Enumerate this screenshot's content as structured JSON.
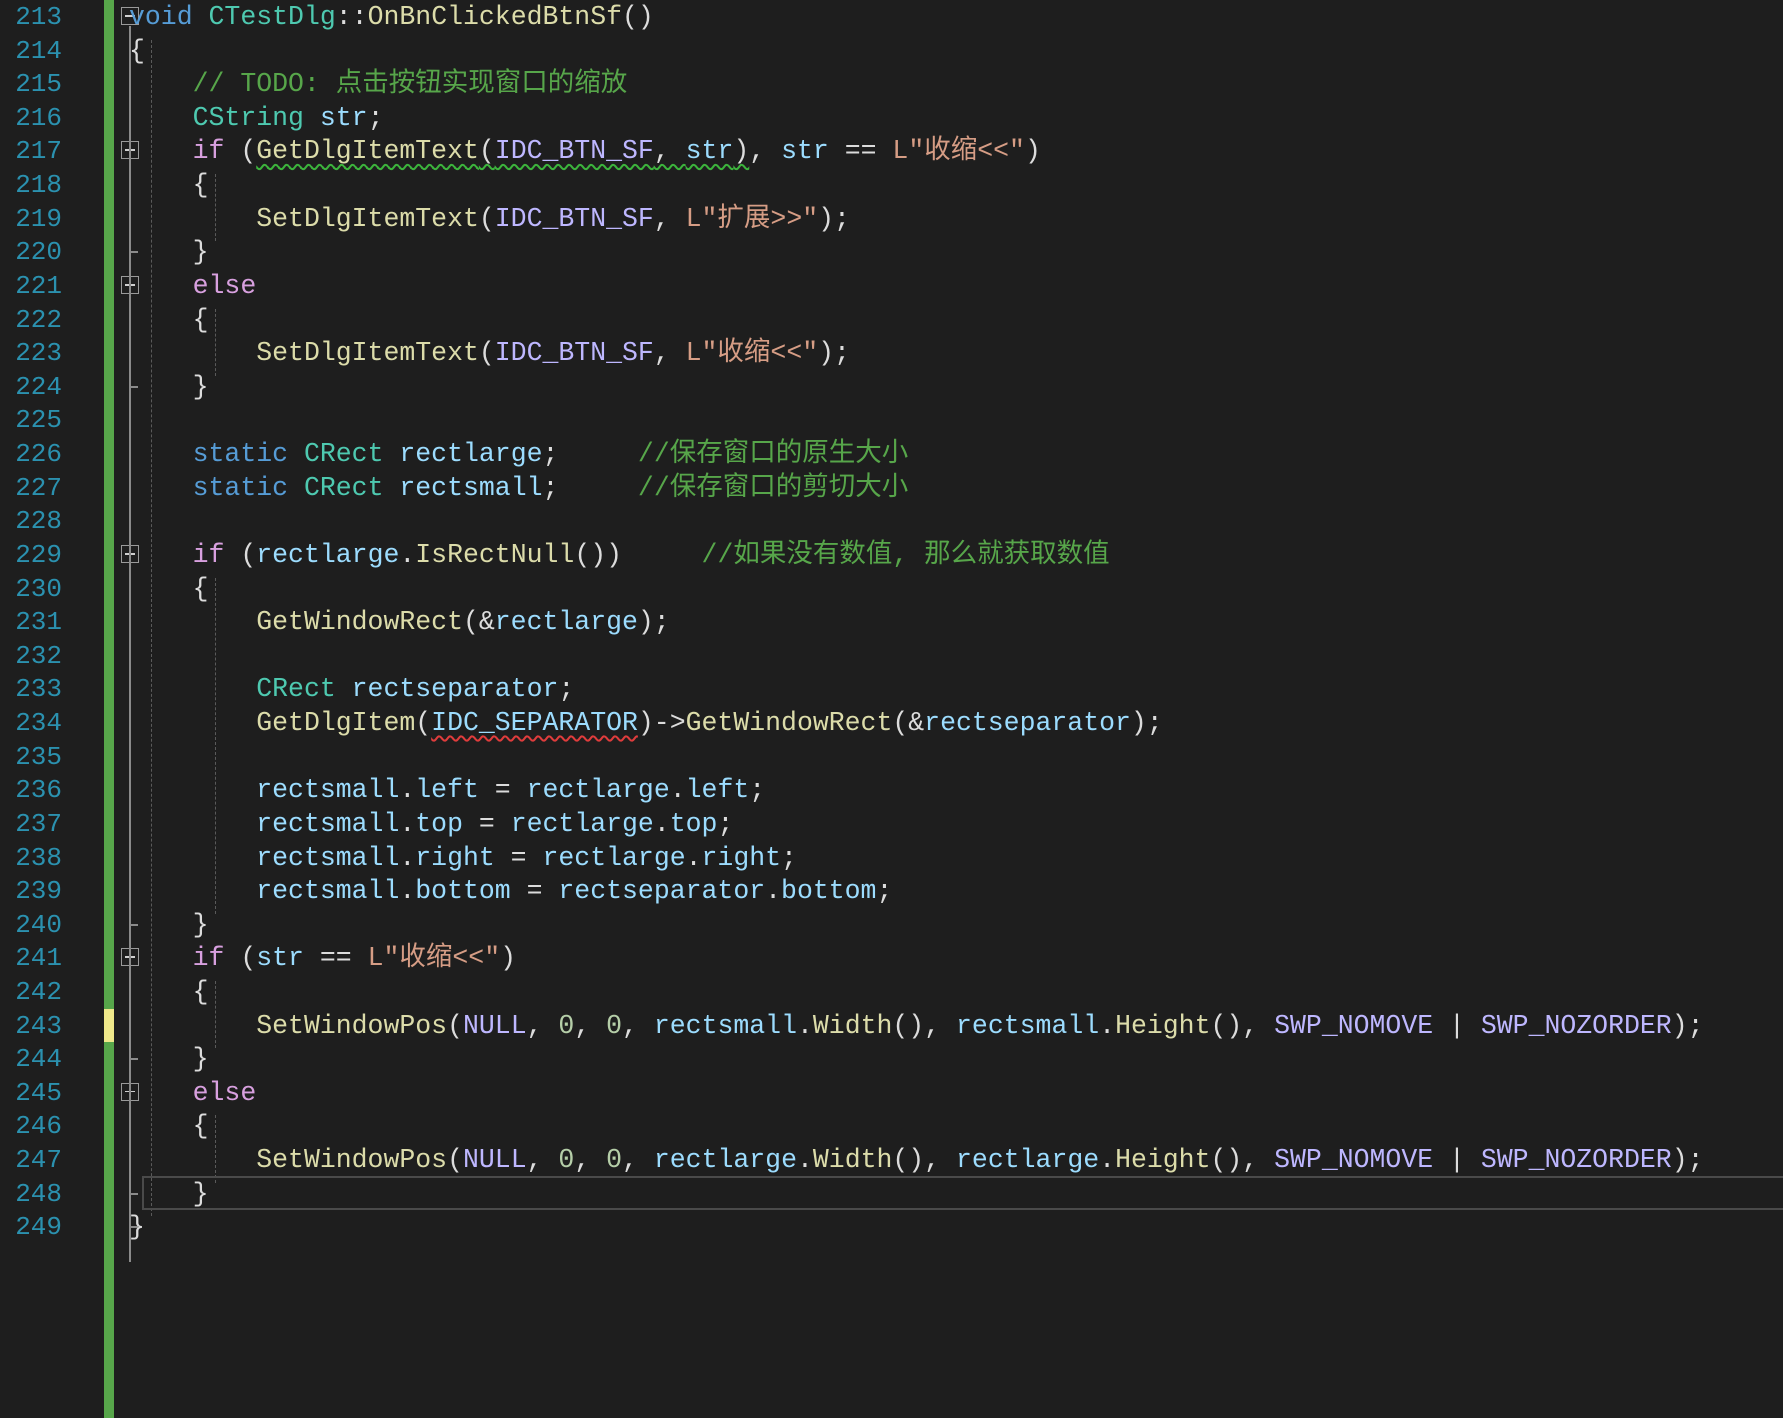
{
  "editor": {
    "colors": {
      "background": "#1e1e1e",
      "line_number": "#2b91af",
      "default": "#dcdcdc",
      "keyword": "#569cd6",
      "control": "#d8a0df",
      "type": "#4ec9b0",
      "function": "#dcdcaa",
      "variable": "#9cdcfe",
      "macro": "#beb7ff",
      "string": "#d69d85",
      "comment": "#57a64a",
      "number": "#b5cea8",
      "change_saved": "#57a64a",
      "change_unsaved": "#efe88a"
    },
    "lines": [
      {
        "number": "213",
        "fold": "minus",
        "tokens": [
          {
            "t": "void",
            "c": "keyword"
          },
          {
            "t": " ",
            "c": "default"
          },
          {
            "t": "CTestDlg",
            "c": "type"
          },
          {
            "t": "::",
            "c": "default"
          },
          {
            "t": "OnBnClickedBtnSf",
            "c": "function"
          },
          {
            "t": "()",
            "c": "default"
          }
        ]
      },
      {
        "number": "214",
        "tokens": [
          {
            "t": "{",
            "c": "default"
          }
        ]
      },
      {
        "number": "215",
        "tokens": [
          {
            "t": "    // TODO: 点击按钮实现窗口的缩放",
            "c": "comment"
          }
        ]
      },
      {
        "number": "216",
        "tokens": [
          {
            "t": "    ",
            "c": "default"
          },
          {
            "t": "CString",
            "c": "type"
          },
          {
            "t": " ",
            "c": "default"
          },
          {
            "t": "str",
            "c": "variable"
          },
          {
            "t": ";",
            "c": "default"
          }
        ]
      },
      {
        "number": "217",
        "fold": "minus",
        "tokens": [
          {
            "t": "    ",
            "c": "default"
          },
          {
            "t": "if",
            "c": "control"
          },
          {
            "t": " (",
            "c": "default"
          },
          {
            "t": "GetDlgItemText",
            "c": "function",
            "sq": "g"
          },
          {
            "t": "(",
            "c": "default",
            "sq": "g"
          },
          {
            "t": "IDC_BTN_SF",
            "c": "macro",
            "sq": "g"
          },
          {
            "t": ", ",
            "c": "default",
            "sq": "g"
          },
          {
            "t": "str",
            "c": "variable",
            "sq": "g"
          },
          {
            "t": ")",
            "c": "default",
            "sq": "g"
          },
          {
            "t": ", ",
            "c": "default"
          },
          {
            "t": "str",
            "c": "variable"
          },
          {
            "t": " == ",
            "c": "default"
          },
          {
            "t": "L\"收缩<<\"",
            "c": "string"
          },
          {
            "t": ")",
            "c": "default"
          }
        ]
      },
      {
        "number": "218",
        "tokens": [
          {
            "t": "    {",
            "c": "default"
          }
        ]
      },
      {
        "number": "219",
        "tokens": [
          {
            "t": "        ",
            "c": "default"
          },
          {
            "t": "SetDlgItemText",
            "c": "function"
          },
          {
            "t": "(",
            "c": "default"
          },
          {
            "t": "IDC_BTN_SF",
            "c": "macro"
          },
          {
            "t": ", ",
            "c": "default"
          },
          {
            "t": "L\"扩展>>\"",
            "c": "string"
          },
          {
            "t": ");",
            "c": "default"
          }
        ]
      },
      {
        "number": "220",
        "tokens": [
          {
            "t": "    }",
            "c": "default"
          }
        ]
      },
      {
        "number": "221",
        "fold": "minus",
        "tokens": [
          {
            "t": "    ",
            "c": "default"
          },
          {
            "t": "else",
            "c": "control"
          }
        ]
      },
      {
        "number": "222",
        "tokens": [
          {
            "t": "    {",
            "c": "default"
          }
        ]
      },
      {
        "number": "223",
        "tokens": [
          {
            "t": "        ",
            "c": "default"
          },
          {
            "t": "SetDlgItemText",
            "c": "function"
          },
          {
            "t": "(",
            "c": "default"
          },
          {
            "t": "IDC_BTN_SF",
            "c": "macro"
          },
          {
            "t": ", ",
            "c": "default"
          },
          {
            "t": "L\"收缩<<\"",
            "c": "string"
          },
          {
            "t": ");",
            "c": "default"
          }
        ]
      },
      {
        "number": "224",
        "tokens": [
          {
            "t": "    }",
            "c": "default"
          }
        ]
      },
      {
        "number": "225",
        "tokens": []
      },
      {
        "number": "226",
        "tokens": [
          {
            "t": "    ",
            "c": "default"
          },
          {
            "t": "static",
            "c": "keyword"
          },
          {
            "t": " ",
            "c": "default"
          },
          {
            "t": "CRect",
            "c": "type"
          },
          {
            "t": " ",
            "c": "default"
          },
          {
            "t": "rectlarge",
            "c": "variable"
          },
          {
            "t": ";     ",
            "c": "default"
          },
          {
            "t": "//保存窗口的原生大小",
            "c": "comment"
          }
        ]
      },
      {
        "number": "227",
        "tokens": [
          {
            "t": "    ",
            "c": "default"
          },
          {
            "t": "static",
            "c": "keyword"
          },
          {
            "t": " ",
            "c": "default"
          },
          {
            "t": "CRect",
            "c": "type"
          },
          {
            "t": " ",
            "c": "default"
          },
          {
            "t": "rectsmall",
            "c": "variable"
          },
          {
            "t": ";     ",
            "c": "default"
          },
          {
            "t": "//保存窗口的剪切大小",
            "c": "comment"
          }
        ]
      },
      {
        "number": "228",
        "tokens": []
      },
      {
        "number": "229",
        "fold": "minus",
        "tokens": [
          {
            "t": "    ",
            "c": "default"
          },
          {
            "t": "if",
            "c": "control"
          },
          {
            "t": " (",
            "c": "default"
          },
          {
            "t": "rectlarge",
            "c": "variable"
          },
          {
            "t": ".",
            "c": "default"
          },
          {
            "t": "IsRectNull",
            "c": "function"
          },
          {
            "t": "())     ",
            "c": "default"
          },
          {
            "t": "//如果没有数值, 那么就获取数值",
            "c": "comment"
          }
        ]
      },
      {
        "number": "230",
        "tokens": [
          {
            "t": "    {",
            "c": "default"
          }
        ]
      },
      {
        "number": "231",
        "tokens": [
          {
            "t": "        ",
            "c": "default"
          },
          {
            "t": "GetWindowRect",
            "c": "function"
          },
          {
            "t": "(&",
            "c": "default"
          },
          {
            "t": "rectlarge",
            "c": "variable"
          },
          {
            "t": ");",
            "c": "default"
          }
        ]
      },
      {
        "number": "232",
        "tokens": []
      },
      {
        "number": "233",
        "tokens": [
          {
            "t": "        ",
            "c": "default"
          },
          {
            "t": "CRect",
            "c": "type"
          },
          {
            "t": " ",
            "c": "default"
          },
          {
            "t": "rectseparator",
            "c": "variable"
          },
          {
            "t": ";",
            "c": "default"
          }
        ]
      },
      {
        "number": "234",
        "tokens": [
          {
            "t": "        ",
            "c": "default"
          },
          {
            "t": "GetDlgItem",
            "c": "function"
          },
          {
            "t": "(",
            "c": "default"
          },
          {
            "t": "IDC_SEPARATOR",
            "c": "variable",
            "sq": "r"
          },
          {
            "t": ")->",
            "c": "default"
          },
          {
            "t": "GetWindowRect",
            "c": "function"
          },
          {
            "t": "(&",
            "c": "default"
          },
          {
            "t": "rectseparator",
            "c": "variable"
          },
          {
            "t": ");",
            "c": "default"
          }
        ]
      },
      {
        "number": "235",
        "tokens": []
      },
      {
        "number": "236",
        "tokens": [
          {
            "t": "        ",
            "c": "default"
          },
          {
            "t": "rectsmall",
            "c": "variable"
          },
          {
            "t": ".",
            "c": "default"
          },
          {
            "t": "left",
            "c": "variable"
          },
          {
            "t": " = ",
            "c": "default"
          },
          {
            "t": "rectlarge",
            "c": "variable"
          },
          {
            "t": ".",
            "c": "default"
          },
          {
            "t": "left",
            "c": "variable"
          },
          {
            "t": ";",
            "c": "default"
          }
        ]
      },
      {
        "number": "237",
        "tokens": [
          {
            "t": "        ",
            "c": "default"
          },
          {
            "t": "rectsmall",
            "c": "variable"
          },
          {
            "t": ".",
            "c": "default"
          },
          {
            "t": "top",
            "c": "variable"
          },
          {
            "t": " = ",
            "c": "default"
          },
          {
            "t": "rectlarge",
            "c": "variable"
          },
          {
            "t": ".",
            "c": "default"
          },
          {
            "t": "top",
            "c": "variable"
          },
          {
            "t": ";",
            "c": "default"
          }
        ]
      },
      {
        "number": "238",
        "tokens": [
          {
            "t": "        ",
            "c": "default"
          },
          {
            "t": "rectsmall",
            "c": "variable"
          },
          {
            "t": ".",
            "c": "default"
          },
          {
            "t": "right",
            "c": "variable"
          },
          {
            "t": " = ",
            "c": "default"
          },
          {
            "t": "rectlarge",
            "c": "variable"
          },
          {
            "t": ".",
            "c": "default"
          },
          {
            "t": "right",
            "c": "variable"
          },
          {
            "t": ";",
            "c": "default"
          }
        ]
      },
      {
        "number": "239",
        "tokens": [
          {
            "t": "        ",
            "c": "default"
          },
          {
            "t": "rectsmall",
            "c": "variable"
          },
          {
            "t": ".",
            "c": "default"
          },
          {
            "t": "bottom",
            "c": "variable"
          },
          {
            "t": " = ",
            "c": "default"
          },
          {
            "t": "rectseparator",
            "c": "variable"
          },
          {
            "t": ".",
            "c": "default"
          },
          {
            "t": "bottom",
            "c": "variable"
          },
          {
            "t": ";",
            "c": "default"
          }
        ]
      },
      {
        "number": "240",
        "tokens": [
          {
            "t": "    }",
            "c": "default"
          }
        ]
      },
      {
        "number": "241",
        "fold": "minus",
        "tokens": [
          {
            "t": "    ",
            "c": "default"
          },
          {
            "t": "if",
            "c": "control"
          },
          {
            "t": " (",
            "c": "default"
          },
          {
            "t": "str",
            "c": "variable"
          },
          {
            "t": " == ",
            "c": "default"
          },
          {
            "t": "L\"收缩<<\"",
            "c": "string"
          },
          {
            "t": ")",
            "c": "default"
          }
        ]
      },
      {
        "number": "242",
        "tokens": [
          {
            "t": "    {",
            "c": "default"
          }
        ]
      },
      {
        "number": "243",
        "change": "unsaved",
        "tokens": [
          {
            "t": "        ",
            "c": "default"
          },
          {
            "t": "SetWindowPos",
            "c": "function"
          },
          {
            "t": "(",
            "c": "default"
          },
          {
            "t": "NULL",
            "c": "macro"
          },
          {
            "t": ", ",
            "c": "default"
          },
          {
            "t": "0",
            "c": "number"
          },
          {
            "t": ", ",
            "c": "default"
          },
          {
            "t": "0",
            "c": "number"
          },
          {
            "t": ", ",
            "c": "default"
          },
          {
            "t": "rectsmall",
            "c": "variable"
          },
          {
            "t": ".",
            "c": "default"
          },
          {
            "t": "Width",
            "c": "function"
          },
          {
            "t": "(), ",
            "c": "default"
          },
          {
            "t": "rectsmall",
            "c": "variable"
          },
          {
            "t": ".",
            "c": "default"
          },
          {
            "t": "Height",
            "c": "function"
          },
          {
            "t": "(), ",
            "c": "default"
          },
          {
            "t": "SWP_NOMOVE",
            "c": "macro"
          },
          {
            "t": " | ",
            "c": "default"
          },
          {
            "t": "SWP_NOZORDER",
            "c": "macro"
          },
          {
            "t": ");",
            "c": "default"
          }
        ]
      },
      {
        "number": "244",
        "tokens": [
          {
            "t": "    }",
            "c": "default"
          }
        ]
      },
      {
        "number": "245",
        "fold": "minus",
        "tokens": [
          {
            "t": "    ",
            "c": "default"
          },
          {
            "t": "else",
            "c": "control"
          }
        ]
      },
      {
        "number": "246",
        "tokens": [
          {
            "t": "    {",
            "c": "default"
          }
        ]
      },
      {
        "number": "247",
        "tokens": [
          {
            "t": "        ",
            "c": "default"
          },
          {
            "t": "SetWindowPos",
            "c": "function"
          },
          {
            "t": "(",
            "c": "default"
          },
          {
            "t": "NULL",
            "c": "macro"
          },
          {
            "t": ", ",
            "c": "default"
          },
          {
            "t": "0",
            "c": "number"
          },
          {
            "t": ", ",
            "c": "default"
          },
          {
            "t": "0",
            "c": "number"
          },
          {
            "t": ", ",
            "c": "default"
          },
          {
            "t": "rectlarge",
            "c": "variable"
          },
          {
            "t": ".",
            "c": "default"
          },
          {
            "t": "Width",
            "c": "function"
          },
          {
            "t": "(), ",
            "c": "default"
          },
          {
            "t": "rectlarge",
            "c": "variable"
          },
          {
            "t": ".",
            "c": "default"
          },
          {
            "t": "Height",
            "c": "function"
          },
          {
            "t": "(), ",
            "c": "default"
          },
          {
            "t": "SWP_NOMOVE",
            "c": "macro"
          },
          {
            "t": " | ",
            "c": "default"
          },
          {
            "t": "SWP_NOZORDER",
            "c": "macro"
          },
          {
            "t": ");",
            "c": "default"
          }
        ]
      },
      {
        "number": "248",
        "current": true,
        "tokens": [
          {
            "t": "    }",
            "c": "default"
          }
        ]
      },
      {
        "number": "249",
        "tokens": [
          {
            "t": "}",
            "c": "default"
          }
        ]
      }
    ]
  }
}
